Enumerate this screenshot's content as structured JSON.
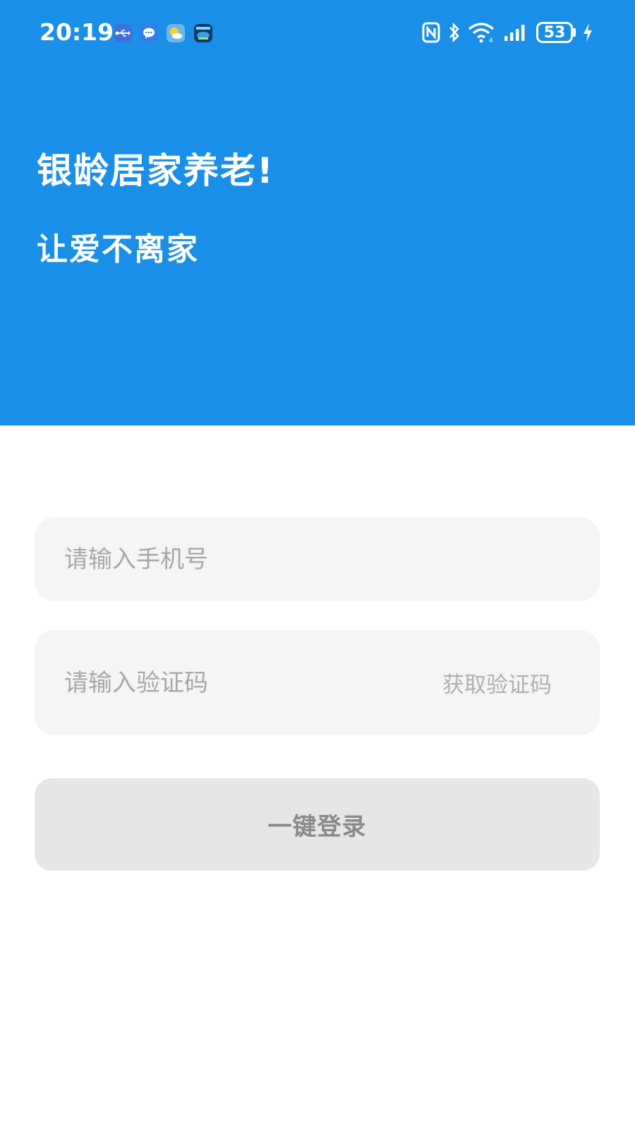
{
  "status_bar": {
    "time": "20:19",
    "battery": "53",
    "notification_icons": [
      "usb-icon",
      "message-icon",
      "weather-icon",
      "game-icon"
    ],
    "system_icons": [
      "nfc-icon",
      "bluetooth-icon",
      "wifi-icon",
      "signal-icon",
      "battery-icon",
      "charging-icon"
    ]
  },
  "header": {
    "title": "银龄居家养老!",
    "subtitle": "让爱不离家",
    "background_color": "#1a8fe8"
  },
  "form": {
    "phone_placeholder": "请输入手机号",
    "code_placeholder": "请输入验证码",
    "get_code_label": "获取验证码",
    "login_label": "一键登录"
  }
}
